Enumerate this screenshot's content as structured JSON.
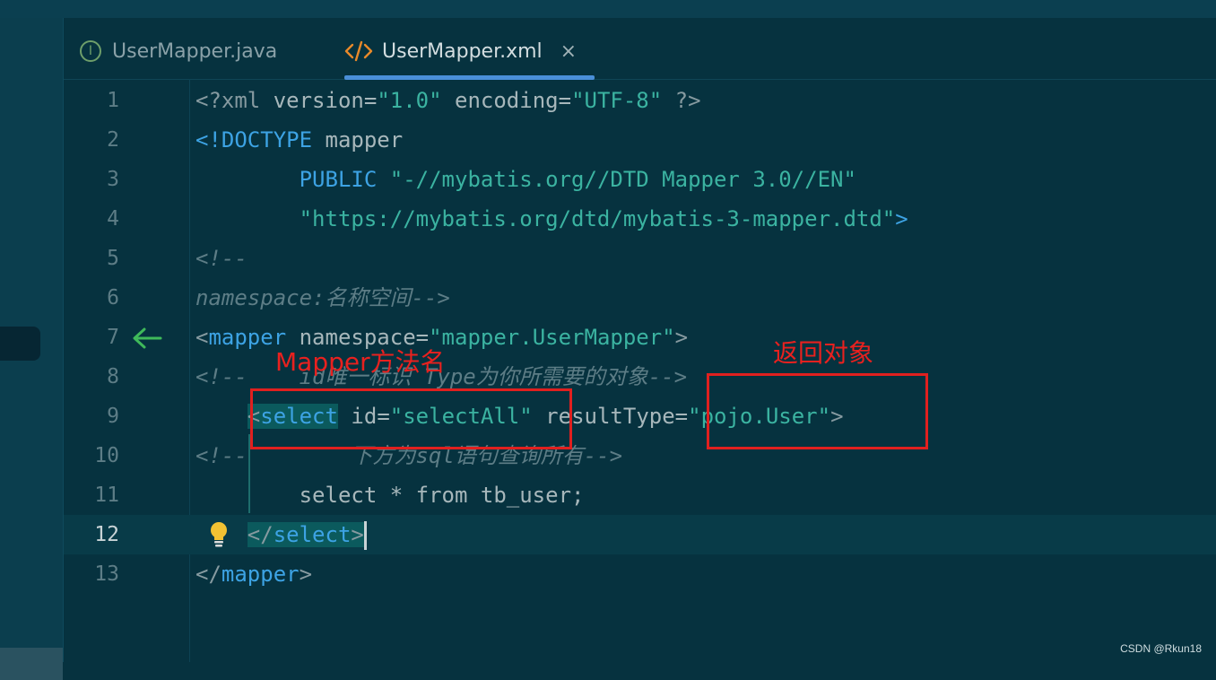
{
  "tabs": [
    {
      "label": "UserMapper.java",
      "icon": "interface-icon",
      "active": false
    },
    {
      "label": "UserMapper.xml",
      "icon": "xml-icon",
      "active": true
    }
  ],
  "tab_close_glyph": "×",
  "current_line": 12,
  "lines": [
    {
      "num": "1",
      "tokens": [
        {
          "t": "<?xml ",
          "c": "ang"
        },
        {
          "t": "version",
          "c": "attr"
        },
        {
          "t": "=",
          "c": "plain"
        },
        {
          "t": "\"1.0\"",
          "c": "str"
        },
        {
          "t": " encoding",
          "c": "attr"
        },
        {
          "t": "=",
          "c": "plain"
        },
        {
          "t": "\"UTF-8\"",
          "c": "str"
        },
        {
          "t": " ?>",
          "c": "ang"
        }
      ]
    },
    {
      "num": "2",
      "tokens": [
        {
          "t": "<!DOCTYPE",
          "c": "kw"
        },
        {
          "t": " mapper",
          "c": "plain"
        }
      ]
    },
    {
      "num": "3",
      "tokens": [
        {
          "t": "        ",
          "c": "plain"
        },
        {
          "t": "PUBLIC",
          "c": "kw"
        },
        {
          "t": " ",
          "c": "plain"
        },
        {
          "t": "\"-//mybatis.org//DTD Mapper 3.0//EN\"",
          "c": "str"
        }
      ]
    },
    {
      "num": "4",
      "tokens": [
        {
          "t": "        ",
          "c": "plain"
        },
        {
          "t": "\"https://mybatis.org/dtd/mybatis-3-mapper.dtd\"",
          "c": "str"
        },
        {
          "t": ">",
          "c": "kw"
        }
      ]
    },
    {
      "num": "5",
      "tokens": [
        {
          "t": "<!--",
          "c": "com"
        }
      ]
    },
    {
      "num": "6",
      "tokens": [
        {
          "t": "namespace:名称空间-->",
          "c": "com"
        }
      ]
    },
    {
      "num": "7",
      "tokens": [
        {
          "t": "<",
          "c": "ang"
        },
        {
          "t": "mapper",
          "c": "kw"
        },
        {
          "t": " namespace",
          "c": "attr"
        },
        {
          "t": "=",
          "c": "plain"
        },
        {
          "t": "\"mapper.UserMapper\"",
          "c": "str"
        },
        {
          "t": ">",
          "c": "ang"
        }
      ]
    },
    {
      "num": "8",
      "tokens": [
        {
          "t": "<!--    id唯一标识 Type为你所需要的对象-->",
          "c": "com"
        }
      ]
    },
    {
      "num": "9",
      "tokens": [
        {
          "t": "    ",
          "c": "plain"
        },
        {
          "t": "<",
          "c": "ang",
          "hl": true
        },
        {
          "t": "select",
          "c": "kw",
          "hl": true
        },
        {
          "t": " id",
          "c": "attr"
        },
        {
          "t": "=",
          "c": "plain"
        },
        {
          "t": "\"selectAll\"",
          "c": "str"
        },
        {
          "t": " resultType",
          "c": "attr"
        },
        {
          "t": "=",
          "c": "plain"
        },
        {
          "t": "\"pojo.User\"",
          "c": "str"
        },
        {
          "t": ">",
          "c": "ang"
        }
      ]
    },
    {
      "num": "10",
      "tokens": [
        {
          "t": "<!--        下方为sql语句查询所有-->",
          "c": "com"
        }
      ]
    },
    {
      "num": "11",
      "tokens": [
        {
          "t": "        select * from tb_user;",
          "c": "plain"
        }
      ]
    },
    {
      "num": "12",
      "tokens": [
        {
          "t": "    ",
          "c": "plain"
        },
        {
          "t": "</",
          "c": "ang",
          "hl": true
        },
        {
          "t": "select",
          "c": "kw",
          "hl": true
        },
        {
          "t": ">",
          "c": "ang",
          "hl": true
        }
      ]
    },
    {
      "num": "13",
      "tokens": [
        {
          "t": "</",
          "c": "ang"
        },
        {
          "t": "mapper",
          "c": "kw"
        },
        {
          "t": ">",
          "c": "ang"
        }
      ]
    }
  ],
  "annotations": {
    "method_label": "Mapper方法名",
    "return_label": "返回对象",
    "color": "#e0201f"
  },
  "watermark": "CSDN @Rkun18",
  "colors": {
    "background": "#06323f",
    "keyword": "#3da3e4",
    "string": "#3bb3a1",
    "comment": "#5d7d86",
    "tab_accent": "#4a8fd8"
  }
}
